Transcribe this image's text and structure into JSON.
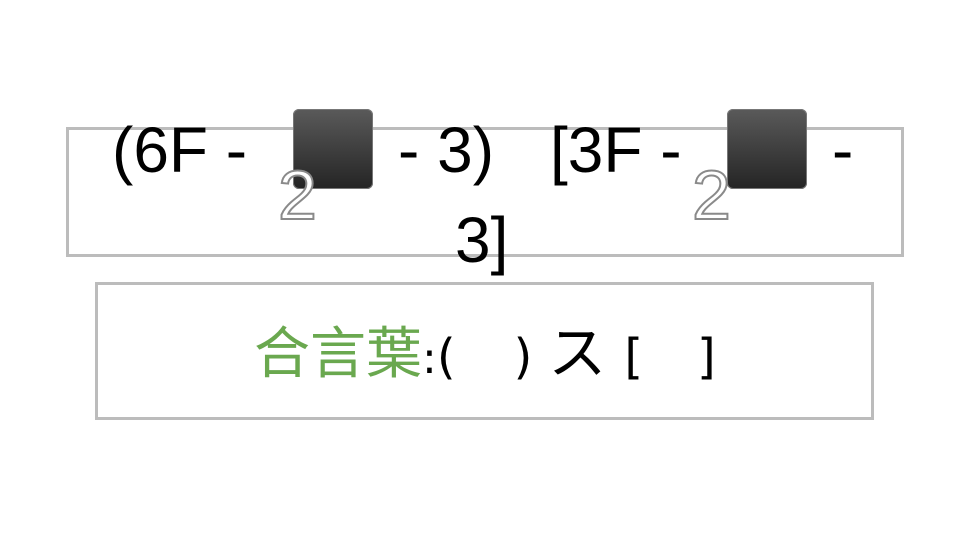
{
  "formula": {
    "left_expr_open": "(6F -",
    "left_expr_close": "- 3)",
    "right_expr_open": "[3F -",
    "right_expr_close": "-",
    "right_expr_tail": "3]",
    "hidden_tile_subscript": "2"
  },
  "password": {
    "label": "合言葉",
    "colon": ":",
    "paren_open": "(",
    "paren_close": ")",
    "kana": "ス",
    "bracket_open": "[",
    "bracket_close": "]"
  },
  "colors": {
    "label_green": "#6aa84f",
    "box_border": "#bcbcbc",
    "tile_dark": "#2b2b2b"
  }
}
